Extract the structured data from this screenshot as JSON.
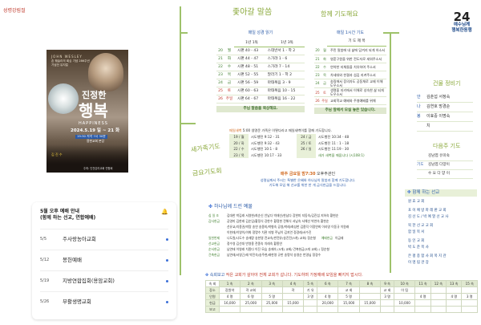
{
  "header": {
    "top_left": "성령강림절"
  },
  "logo": {
    "number": "24",
    "line1": "예수님께",
    "line2": "행복한동행"
  },
  "section_titles": {
    "follow": "좇아갈 말씀",
    "pray_together": "함께 기도해요",
    "prayer_list": "기도해요",
    "new_family": "새가족기도",
    "pray_more": "금요기도회",
    "church_news": "하나님께 드린 예물",
    "we_pray": "함께 하는 선교",
    "attendance": "속회보고"
  },
  "bible_reading": {
    "label": "매일 성경 읽기",
    "col1": "1년 1독",
    "col2": "1년 3독",
    "rows": [
      {
        "d": "20",
        "w": "월",
        "a": "시편 40 - 43",
        "b": "스데반서 1 - 학 2"
      },
      {
        "d": "21",
        "w": "화",
        "a": "시편 44 - 47",
        "b": "스가랴 1 - 6"
      },
      {
        "d": "22",
        "w": "수",
        "a": "시편 48 - 51",
        "b": "스가랴 7 - 14"
      },
      {
        "d": "23",
        "w": "목",
        "a": "시편 52 - 55",
        "b": "말라기 1 - 학 2"
      },
      {
        "d": "24",
        "w": "금",
        "a": "시편 56 - 59",
        "b": "마태복음 3 - 9"
      },
      {
        "d": "25",
        "w": "토",
        "a": "시편 60 - 63",
        "b": "마태복음 10 - 15"
      },
      {
        "d": "26",
        "w": "주일",
        "a": "시편 64 - 67",
        "b": "마태복음 16 - 22"
      }
    ],
    "footer": "주님 말씀을 묵상해요."
  },
  "daily_prayer": {
    "label": "매일 1시간 기도",
    "head": "기 도 제 목",
    "rows": [
      {
        "d": "20",
        "w": "월",
        "t": "주민 말씀에 내 삶에 담겨지 되게 하소서"
      },
      {
        "d": "21",
        "w": "화",
        "t": "영혼구원을 위한 전도자로 세워주소서"
      },
      {
        "d": "22",
        "w": "수",
        "t": "연약한 지체들을 치유하여 주소서"
      },
      {
        "d": "23",
        "w": "목",
        "t": "차세대와 한결과 섬김 지켜주소서"
      },
      {
        "d": "24",
        "w": "금",
        "t": "송림에서 증의자도 공동체로 교제 이해 도우소서"
      },
      {
        "d": "25",
        "w": "토",
        "t": "생명을 지키에서 이해로 성숙한 삶 되게 도우소서"
      },
      {
        "d": "26",
        "w": "주일",
        "t": "교회학교 예배와 주영예배를 위해"
      }
    ],
    "footer": "주님 앞에서 모실 놓은 있습니다."
  },
  "poster": {
    "kicker": "JOHN WESLEY",
    "sub1": "존 웨슬리의 회심 기념 286주년",
    "sub2": "기념전 뮤지컬",
    "title": "진정한",
    "title2": "행복",
    "english": "HAPPINESS",
    "date": "2024.5.19 일 ~ 21 화",
    "time": "19:30 저녁 7시 30분",
    "venue": "용현교회 본당",
    "speaker": "김 진 수",
    "bottom": "주최: 인천감리교회 연합회"
  },
  "new_family_table": {
    "header_a": "매일새벽",
    "header_b": "5:00 생명운 가족은 이렇다라고 매일새벽이를 함께 기도합니다.",
    "rows": [
      [
        "19 / 월",
        "시도행전 9:12 - 31",
        "24 / 금",
        "시도행전 10:34 - 48"
      ],
      [
        "20 / 화",
        "시도행전 9:32 - 43",
        "25 / 토",
        "시도행전 11 : 1 - 18"
      ],
      [
        "22 / 수",
        "시도행전 10:1 - 8",
        "26 / 일",
        "시도행전 11:19 - 30"
      ],
      [
        "23 / 목",
        "시도행전 10:17 - 33",
        "",
        "새가 새벽을 깨웁니다 (시108:1)"
      ]
    ]
  },
  "friday": {
    "title": "매주 금요일 밤7:30",
    "sub": "오후주관인",
    "line1": "성령님께서 주시는 특별한 은혜와 하나님의 말씀과 함께 기도합니다.",
    "line2": "기도해 모임 해 선교를 위한 한 개 금식헌금을 드립니다."
  },
  "offering": {
    "title": "하나님께 드린 예물",
    "rows": [
      {
        "k": "십 일 조",
        "v": "김대한 박김래 서영현/최순신 안남다 박래선/한남다 장한미 지동숙/김진섭 지하숙 황현순"
      },
      {
        "k": "감사헌금",
        "v": "공영미 김한래 김순임/황정식 강한수 황정현 전해식 서남숙 서해선 박연숙 황현순"
      },
      {
        "k": "",
        "v": "선유교/치종권/박량 송연 송종미/박형숙 공영/박래/최성한 김종덕 이정연희 이라영 이동규 이원래"
      },
      {
        "k": "",
        "v": "이한래/이영이/이화 정명수 치관 지병 주님이 김지언 정경래/서수진"
      },
      {
        "k": "일천번제",
        "v": "나도원/나도수 송재량 송한영 전교숙/반전유/송진전(3개) 교회/ 정순형",
        "k2": "예배헌금",
        "v2": "이금태"
      },
      {
        "k": "선교헌금",
        "v": "정수영 김선대 반영용 전종숙 치래숙 황종연"
      },
      {
        "k": "순서헌금",
        "v": "남연태 이영래 치종다 이진 모습 송재숙 (5개) 교회/ 건축헌금(3개 교회) / 정순형"
      },
      {
        "k": "건축헌금",
        "v": "남연래/서영근/래 박진숙/송주현/래한영 규한 송명석 송영순 반영님 정경수"
      }
    ]
  },
  "right_column": {
    "t1": "건물 정비기",
    "items1": [
      {
        "a": "안",
        "b": "김춘섭 서정숙"
      },
      {
        "a": "나",
        "b": "김연호 방경순"
      },
      {
        "a": "봉",
        "b": "이효중 이명숙"
      },
      {
        "a": "",
        "b": "치"
      }
    ],
    "t2": "다음주 기도",
    "items2": [
      {
        "a": "",
        "b": "김남엽 유미숙"
      },
      {
        "a": "기도",
        "b": "김남엽 다양이"
      },
      {
        "a": "",
        "b": "수 요 다 양 이"
      }
    ],
    "we_pray_title": "함께 하는 선교",
    "missions": [
      "원 효 교 회",
      "포 이 예 방 파 레 판 교 회",
      "김 선 도 / 박 예 열 선 교 사",
      "북 한 선 교 교 회",
      "함 일 목 서",
      "동 인 교 회",
      "박 도 준 목 사",
      "은 평 종 합 사 회 복 지 관",
      "이 명 림 관 장"
    ]
  },
  "worship_card": {
    "title": "5월 오후 예배 안내",
    "subtitle": "(함께 하는 선교, 연합예배)",
    "items": [
      {
        "date": "5/5",
        "name": "주사랑농아교회"
      },
      {
        "date": "5/12",
        "name": "봉헌예배"
      },
      {
        "date": "5/19",
        "name": "지방연합집회(용암교회)"
      },
      {
        "date": "5/26",
        "name": "부활생명교회"
      }
    ]
  },
  "attendance": {
    "title": "속회보고",
    "note": "작은 교회가 살아야 전체 교회가 삽니다. 기도하며 가정예배 모임을 빠지지 맙시다.",
    "headers": [
      "속 회",
      "1 속",
      "2 속",
      "3 속",
      "4 속",
      "5 속",
      "6 속",
      "7 속",
      "8 속",
      "9 속",
      "10 속",
      "11 속",
      "12 속",
      "13 속",
      "15 속"
    ],
    "rows": [
      [
        "장소",
        "장원약",
        "곽 교회",
        "",
        "곽",
        "기 유",
        "",
        "교 회",
        "",
        "교 회",
        "이 팀",
        "",
        "",
        "",
        ""
      ],
      [
        "인원",
        "4 명",
        "6 명",
        "5 명",
        "",
        "3 명",
        "4 명",
        "5 명",
        "",
        "3 명",
        "",
        "4 명",
        "",
        "4 명",
        "3 명"
      ],
      [
        "헌금",
        "16,000",
        "25,000",
        "25,000",
        "15,000",
        "",
        "20,000",
        "15,000",
        "15,000",
        "",
        "10,000",
        "",
        "",
        "",
        ""
      ],
      [
        "보고",
        "",
        "",
        "",
        "",
        "",
        "",
        "",
        "",
        "",
        "",
        "",
        "",
        "",
        ""
      ]
    ]
  }
}
